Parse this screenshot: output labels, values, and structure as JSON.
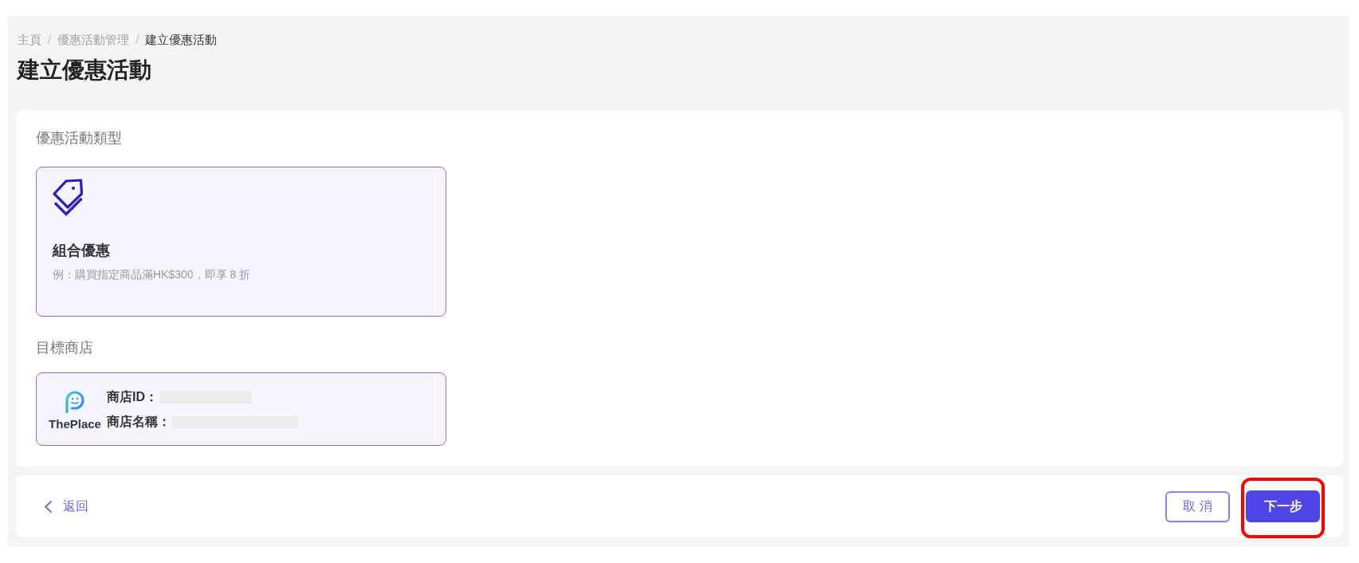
{
  "breadcrumb": {
    "items": [
      {
        "label": "主頁",
        "current": false
      },
      {
        "label": "優惠活動管理",
        "current": false
      },
      {
        "label": "建立優惠活動",
        "current": true
      }
    ],
    "separators": [
      "/",
      "/"
    ]
  },
  "page_title": "建立優惠活動",
  "promotion_type": {
    "label": "優惠活動類型",
    "options": [
      {
        "title": "組合優惠",
        "description": "例：購買指定商品滿HK$300，即享 8 折",
        "selected": true
      }
    ]
  },
  "target_store": {
    "label": "目標商店",
    "logo_text": "ThePlace",
    "fields": [
      {
        "label": "商店ID：",
        "value_redacted": true
      },
      {
        "label": "商店名稱：",
        "value_redacted": true
      }
    ]
  },
  "footer": {
    "back": {
      "label": "返回"
    },
    "buttons": [
      {
        "label": "取 消",
        "kind": "outline",
        "highlighted": false
      },
      {
        "label": "下一步",
        "kind": "primary",
        "highlighted": true
      }
    ]
  }
}
